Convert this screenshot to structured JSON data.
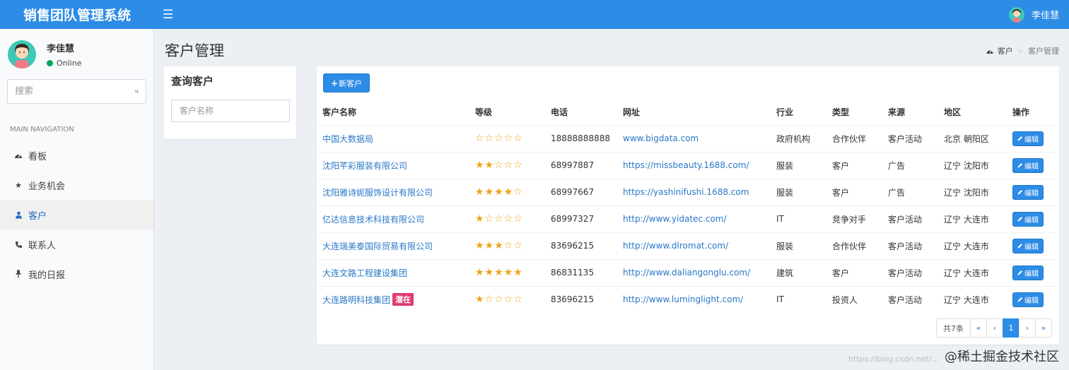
{
  "app": {
    "title": "销售团队管理系统",
    "menu_icon": "hamburger-icon"
  },
  "top_user": {
    "name": "李佳慧"
  },
  "sidebar": {
    "user": {
      "name": "李佳慧",
      "status": "Online"
    },
    "search_placeholder": "搜索",
    "nav_header": "MAIN NAVIGATION",
    "items": [
      {
        "label": "看板",
        "icon": "dashboard-icon"
      },
      {
        "label": "业务机会",
        "icon": "star-icon"
      },
      {
        "label": "客户",
        "icon": "users-icon"
      },
      {
        "label": "联系人",
        "icon": "phone-icon"
      },
      {
        "label": "我的日报",
        "icon": "pin-icon"
      }
    ]
  },
  "page": {
    "title": "客户管理",
    "breadcrumb": [
      "客户",
      "客户管理"
    ]
  },
  "query": {
    "title": "查询客户",
    "name_placeholder": "客户名称"
  },
  "main": {
    "new_button": "新客户",
    "columns": [
      "客户名称",
      "等级",
      "电话",
      "网址",
      "行业",
      "类型",
      "来源",
      "地区",
      "操作"
    ],
    "edit_label": "编辑",
    "rows": [
      {
        "name": "中国大数据局",
        "tag": "",
        "rating": 0,
        "phone": "18888888888",
        "url": "www.bigdata.com",
        "industry": "政府机构",
        "type": "合作伙伴",
        "source": "客户活动",
        "region": "北京 朝阳区"
      },
      {
        "name": "沈阳芊彩服装有限公司",
        "tag": "",
        "rating": 2,
        "phone": "68997887",
        "url": "https://missbeauty.1688.com/",
        "industry": "服装",
        "type": "客户",
        "source": "广告",
        "region": "辽宁 沈阳市"
      },
      {
        "name": "沈阳雅诗妮服饰设计有限公司",
        "tag": "",
        "rating": 4,
        "phone": "68997667",
        "url": "https://yashinifushi.1688.com",
        "industry": "服装",
        "type": "客户",
        "source": "广告",
        "region": "辽宁 沈阳市"
      },
      {
        "name": "亿达信息技术科技有限公司",
        "tag": "",
        "rating": 1,
        "phone": "68997327",
        "url": "http://www.yidatec.com/",
        "industry": "IT",
        "type": "竞争对手",
        "source": "客户活动",
        "region": "辽宁 大连市"
      },
      {
        "name": "大连瑞美泰国际贸易有限公司",
        "tag": "",
        "rating": 3,
        "phone": "83696215",
        "url": "http://www.dlromat.com/",
        "industry": "服装",
        "type": "合作伙伴",
        "source": "客户活动",
        "region": "辽宁 大连市"
      },
      {
        "name": "大连文路工程建设集团",
        "tag": "",
        "rating": 5,
        "phone": "86831135",
        "url": "http://www.daliangonglu.com/",
        "industry": "建筑",
        "type": "客户",
        "source": "客户活动",
        "region": "辽宁 大连市"
      },
      {
        "name": "大连路明科技集团",
        "tag": "潜在",
        "rating": 1,
        "phone": "83696215",
        "url": "http://www.luminglight.com/",
        "industry": "IT",
        "type": "投资人",
        "source": "客户活动",
        "region": "辽宁 大连市"
      }
    ]
  },
  "pagination": {
    "total": "共7条",
    "first": "«",
    "prev": "‹",
    "current": "1",
    "next": "›",
    "last": "»"
  },
  "watermark": {
    "text": "@稀土掘金技术社区",
    "url": "https://blog.csdn.net/..."
  },
  "colors": {
    "primary": "#2c8ce6",
    "star": "#f0a31a",
    "tag": "#dd3b6e",
    "online": "#00a65a"
  }
}
